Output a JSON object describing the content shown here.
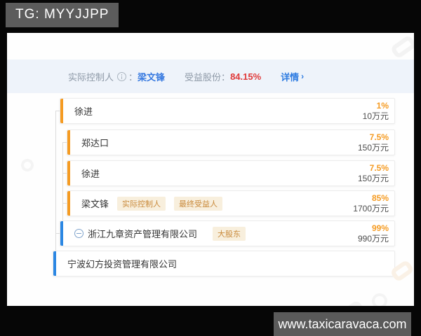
{
  "overlay": {
    "tg_badge": "TG: MYYJJPP",
    "site_badge": "www.taxicaravaca.com"
  },
  "header": {
    "controller_label": "实际控制人",
    "colon": "：",
    "controller_name": "梁文锋",
    "shares_label": "受益股份：",
    "shares_value": "84.15%",
    "details_label": "详情",
    "details_chevron": "›"
  },
  "tree": {
    "rows": [
      {
        "name": "徐进",
        "percent": "1%",
        "amount": "10万元",
        "bar_color": "#f59b22"
      },
      {
        "name": "郑达口",
        "percent": "7.5%",
        "amount": "150万元",
        "bar_color": "#f59b22"
      },
      {
        "name": "徐进",
        "percent": "7.5%",
        "amount": "150万元",
        "bar_color": "#f59b22"
      },
      {
        "name": "梁文锋",
        "percent": "85%",
        "amount": "1700万元",
        "bar_color": "#f59b22",
        "tags": [
          "实际控制人",
          "最终受益人"
        ]
      },
      {
        "name": "浙江九章资产管理有限公司",
        "percent": "99%",
        "amount": "990万元",
        "bar_color": "#2b87e3",
        "tags": [
          "大股东"
        ],
        "collapsible": true
      },
      {
        "name": "宁波幻方投资管理有限公司",
        "bar_color": "#2b87e3"
      }
    ]
  },
  "colors": {
    "accent_orange": "#f59b22",
    "accent_blue": "#2b87e3",
    "link_blue": "#3679e0",
    "alert_red": "#e03a3a",
    "tag_bg": "#f8efdd",
    "tag_text": "#c98a3b",
    "header_band": "#eef3fa"
  }
}
